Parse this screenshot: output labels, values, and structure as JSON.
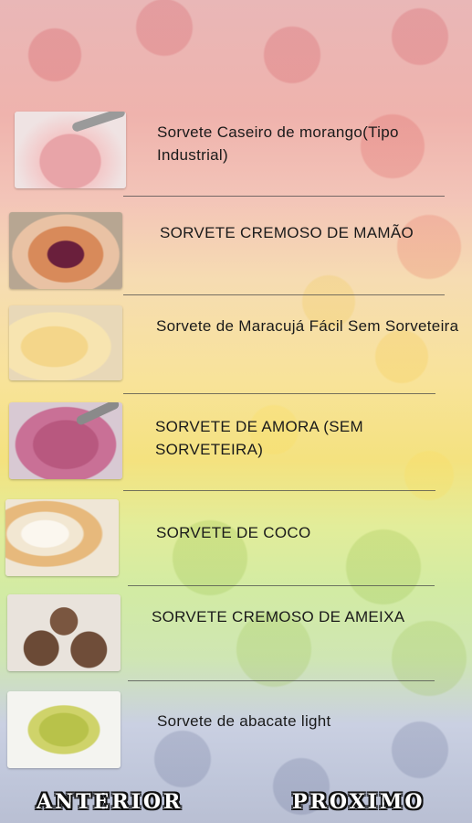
{
  "recipes": [
    {
      "label": "Sorvete Caseiro de morango(Tipo Industrial)",
      "image": "strawberry-ice-cream"
    },
    {
      "label": "SORVETE CREMOSO DE MAMÃO",
      "image": "papaya-ice-cream"
    },
    {
      "label": "Sorvete de Maracujá Fácil Sem Sorveteira",
      "image": "passion-fruit-ice-cream"
    },
    {
      "label": "SORVETE DE AMORA (SEM SORVETEIRA)",
      "image": "blackberry-ice-cream"
    },
    {
      "label": "SORVETE DE COCO",
      "image": "coconut-ice-cream"
    },
    {
      "label": "SORVETE CREMOSO DE AMEIXA",
      "image": "plum-ice-cream"
    },
    {
      "label": "Sorvete de abacate light",
      "image": "avocado-ice-cream"
    }
  ],
  "nav": {
    "previous_label": "ANTERIOR",
    "next_label": "PROXIMO"
  },
  "colors": {
    "text": "#1a1a1a",
    "separator": "#4a4a4a"
  }
}
